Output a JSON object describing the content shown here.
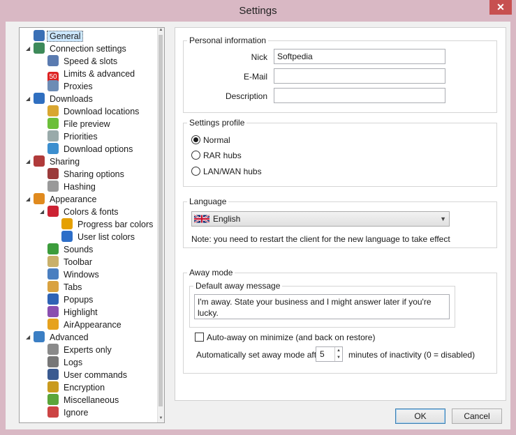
{
  "window": {
    "title": "Settings",
    "close_glyph": "✕"
  },
  "tree": [
    {
      "label": "General",
      "icon": "person-icon",
      "color": "#3a6fb5",
      "level": 0,
      "selected": true
    },
    {
      "label": "Connection settings",
      "icon": "globe-icon",
      "color": "#3d8a5a",
      "level": 0,
      "expander": true
    },
    {
      "label": "Speed & slots",
      "icon": "gauge-icon",
      "color": "#5a7bb0",
      "level": 1
    },
    {
      "label": "Limits & advanced",
      "icon": "speed-limit-icon",
      "color": "#d22",
      "level": 1,
      "glyph": "50"
    },
    {
      "label": "Proxies",
      "icon": "server-icon",
      "color": "#6d8cb5",
      "level": 1
    },
    {
      "label": "Downloads",
      "icon": "download-globe-icon",
      "color": "#2f6fc0",
      "level": 0,
      "expander": true
    },
    {
      "label": "Download locations",
      "icon": "folder-icon",
      "color": "#d9a630",
      "level": 1
    },
    {
      "label": "File preview",
      "icon": "play-icon",
      "color": "#6cbf3a",
      "level": 1
    },
    {
      "label": "Priorities",
      "icon": "priority-icon",
      "color": "#9aa",
      "level": 1
    },
    {
      "label": "Download options",
      "icon": "options-icon",
      "color": "#3c8fcf",
      "level": 1
    },
    {
      "label": "Sharing",
      "icon": "share-icon",
      "color": "#b03a3a",
      "level": 0,
      "expander": true
    },
    {
      "label": "Sharing options",
      "icon": "share-options-icon",
      "color": "#9b3b3b",
      "level": 1
    },
    {
      "label": "Hashing",
      "icon": "database-icon",
      "color": "#999",
      "level": 1
    },
    {
      "label": "Appearance",
      "icon": "palette-icon",
      "color": "#e08a1e",
      "level": 0,
      "expander": true
    },
    {
      "label": "Colors & fonts",
      "icon": "shapes-icon",
      "color": "#c23",
      "level": 1,
      "expander": true
    },
    {
      "label": "Progress bar colors",
      "icon": "progress-icon",
      "color": "#e5a000",
      "level": 2
    },
    {
      "label": "User list colors",
      "icon": "users-icon",
      "color": "#2d6ec8",
      "level": 2
    },
    {
      "label": "Sounds",
      "icon": "speaker-icon",
      "color": "#3c9c3c",
      "level": 1
    },
    {
      "label": "Toolbar",
      "icon": "toolbar-icon",
      "color": "#c9b06a",
      "level": 1
    },
    {
      "label": "Windows",
      "icon": "window-icon",
      "color": "#4a7fc0",
      "level": 1
    },
    {
      "label": "Tabs",
      "icon": "tabs-icon",
      "color": "#d9a240",
      "level": 1
    },
    {
      "label": "Popups",
      "icon": "info-icon",
      "color": "#2f63b5",
      "level": 1
    },
    {
      "label": "Highlight",
      "icon": "highlight-icon",
      "color": "#8a4fb0",
      "level": 1
    },
    {
      "label": "AirAppearance",
      "icon": "umbrella-icon",
      "color": "#e6a21e",
      "level": 1
    },
    {
      "label": "Advanced",
      "icon": "gear-icon",
      "color": "#3b7fc4",
      "level": 0,
      "expander": true
    },
    {
      "label": "Experts only",
      "icon": "gears-icon",
      "color": "#8a8a8a",
      "level": 1
    },
    {
      "label": "Logs",
      "icon": "log-icon",
      "color": "#777",
      "level": 1
    },
    {
      "label": "User commands",
      "icon": "user-command-icon",
      "color": "#3a5a90",
      "level": 1
    },
    {
      "label": "Encryption",
      "icon": "lock-icon",
      "color": "#c99a1e",
      "level": 1
    },
    {
      "label": "Miscellaneous",
      "icon": "pencil-icon",
      "color": "#5aa53a",
      "level": 1
    },
    {
      "label": "Ignore",
      "icon": "ignore-user-icon",
      "color": "#c44",
      "level": 1
    }
  ],
  "personal": {
    "legend": "Personal information",
    "nick_label": "Nick",
    "nick_value": "Softpedia",
    "email_label": "E-Mail",
    "email_value": "",
    "description_label": "Description",
    "description_value": ""
  },
  "profile": {
    "legend": "Settings profile",
    "options": [
      {
        "label": "Normal",
        "checked": true
      },
      {
        "label": "RAR hubs",
        "checked": false
      },
      {
        "label": "LAN/WAN hubs",
        "checked": false
      }
    ]
  },
  "language": {
    "legend": "Language",
    "selected": "English",
    "note": "Note: you need to restart the client for the new language to take effect"
  },
  "away": {
    "legend": "Away mode",
    "default_legend": "Default away message",
    "message": "I'm away. State your business and I might answer later if you're lucky.",
    "auto_away_label": "Auto-away on minimize (and back on restore)",
    "auto_set_label": "Automatically set away mode after",
    "minutes_value": "5",
    "minutes_suffix": "minutes of inactivity (0 = disabled)"
  },
  "buttons": {
    "ok": "OK",
    "cancel": "Cancel"
  }
}
